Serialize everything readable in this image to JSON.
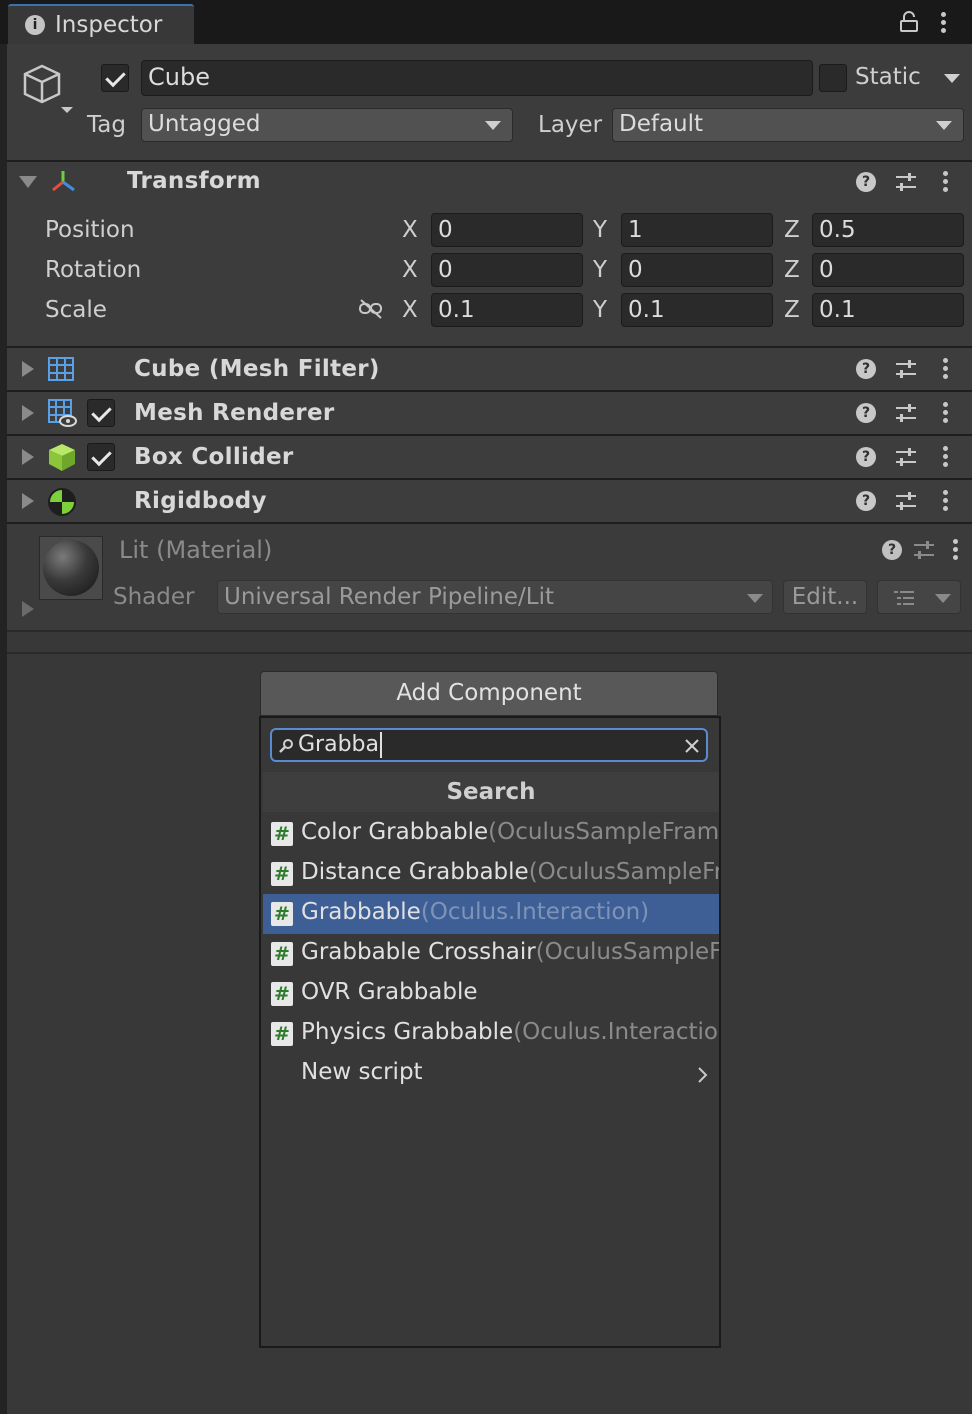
{
  "tab": {
    "title": "Inspector"
  },
  "object": {
    "enabled": true,
    "name": "Cube",
    "static_label": "Static",
    "static_checked": false
  },
  "tag": {
    "label": "Tag",
    "value": "Untagged"
  },
  "layer": {
    "label": "Layer",
    "value": "Default"
  },
  "transform": {
    "title": "Transform",
    "rows": [
      {
        "label": "Position",
        "x": "0",
        "y": "1",
        "z": "0.5"
      },
      {
        "label": "Rotation",
        "x": "0",
        "y": "0",
        "z": "0"
      },
      {
        "label": "Scale",
        "x": "0.1",
        "y": "0.1",
        "z": "0.1"
      }
    ],
    "axes": [
      "X",
      "Y",
      "Z"
    ]
  },
  "components": [
    {
      "title": "Cube (Mesh Filter)",
      "has_checkbox": false,
      "icon": "mesh-filter-icon"
    },
    {
      "title": "Mesh Renderer",
      "has_checkbox": true,
      "icon": "mesh-renderer-icon"
    },
    {
      "title": "Box Collider",
      "has_checkbox": true,
      "icon": "box-collider-icon"
    },
    {
      "title": "Rigidbody",
      "has_checkbox": false,
      "icon": "rigidbody-icon"
    }
  ],
  "material": {
    "title": "Lit (Material)",
    "shader_label": "Shader",
    "shader_value": "Universal Render Pipeline/Lit",
    "edit_label": "Edit..."
  },
  "add_component": {
    "button_label": "Add Component",
    "search_value": "Grabba",
    "section_title": "Search",
    "results": [
      {
        "name": "Color Grabbable",
        "namespace": "(OculusSampleFrame",
        "selected": false
      },
      {
        "name": "Distance Grabbable",
        "namespace": "(OculusSampleFr",
        "selected": false
      },
      {
        "name": "Grabbable",
        "namespace": "(Oculus.Interaction)",
        "selected": true
      },
      {
        "name": "Grabbable Crosshair",
        "namespace": "(OculusSampleFr",
        "selected": false
      },
      {
        "name": "OVR Grabbable",
        "namespace": "",
        "selected": false
      },
      {
        "name": "Physics Grabbable",
        "namespace": "(Oculus.Interactior",
        "selected": false
      }
    ],
    "new_script_label": "New script"
  },
  "colors": {
    "background": "#383838",
    "selection": "#3e5f96",
    "accent_blue": "#3a72b0",
    "script_hash_green": "#2e7d2e"
  }
}
